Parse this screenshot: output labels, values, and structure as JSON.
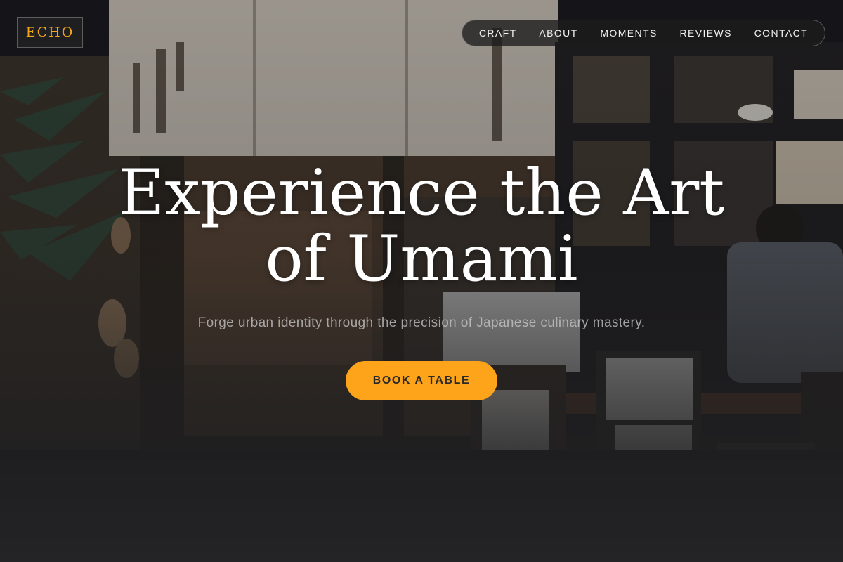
{
  "brand": {
    "logo_text": "ECHO",
    "accent_color": "#fea41a"
  },
  "nav": {
    "items": [
      {
        "label": "CRAFT"
      },
      {
        "label": "ABOUT"
      },
      {
        "label": "MOMENTS"
      },
      {
        "label": "REVIEWS"
      },
      {
        "label": "CONTACT"
      }
    ]
  },
  "hero": {
    "headline_line1": "Experience the Art",
    "headline_line2": "of Umami",
    "subheadline": "Forge urban identity through the precision of Japanese culinary mastery.",
    "cta_label": "BOOK A TABLE"
  }
}
